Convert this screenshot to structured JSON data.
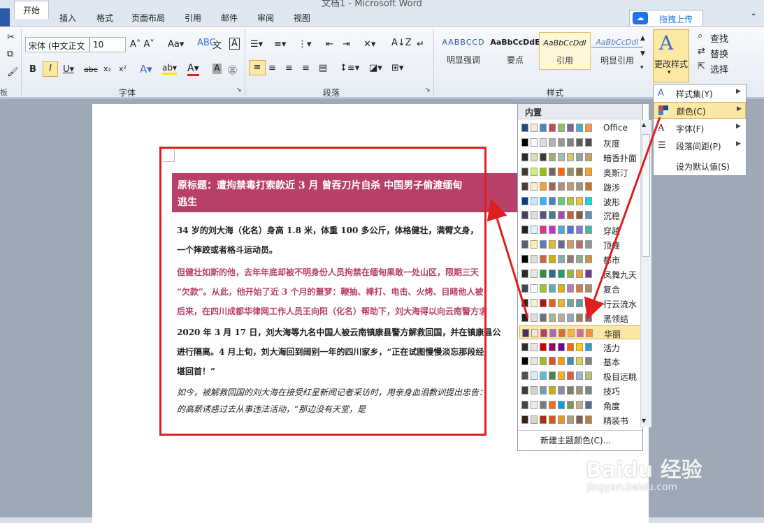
{
  "window": {
    "title": "文档1 - Microsoft Word"
  },
  "tabs": [
    "开始",
    "插入",
    "格式",
    "页面布局",
    "引用",
    "邮件",
    "审阅",
    "视图"
  ],
  "share": {
    "label": "拖拽上传"
  },
  "ribbon": {
    "font_name": "宋体 (中文正文",
    "font_size": "10",
    "groups": {
      "font": "字体",
      "paragraph": "段落",
      "styles": "样式"
    },
    "styles": [
      {
        "preview": "AABBCCD",
        "name": "明显强调"
      },
      {
        "preview": "AaBbCcDdE",
        "name": "要点"
      },
      {
        "preview": "AaBbCcDdI",
        "name": "引用"
      },
      {
        "preview": "AaBbCcDdI",
        "name": "明显引用"
      }
    ],
    "change_styles": "更改样式",
    "editing": {
      "find": "查找",
      "replace": "替换",
      "select": "选择"
    }
  },
  "document": {
    "title_line1": "原标题：遭拘禁毒打索款近 3 月  曾吞刀片自杀  中国男子偷渡缅甸",
    "title_line2": "逃生",
    "p1_line1": "34 岁的刘大海（化名）身高 1.8 米，体重 100 多公斤，体格健壮，满臂文身，",
    "p1_line2": "一个摔跤或者格斗运动员。",
    "p2_line1": "但健壮如斯的他，去年年底却被不明身份人员拘禁在缅甸果敢一处山区，限期三天",
    "p2_line2": "“欠款”。从此，他开始了近 3 个月的噩梦：鞭抽、棒打、电击、火烤、目睹他人被",
    "p2_line3": "后来，在四川成都华律网工作人员王向阳（化名）帮助下，刘大海得以向云南警方求",
    "p3_line1": "2020 年 3 月 17 日，刘大海等九名中国人被云南镇康县警方解救回国，并在镇康县公",
    "p3_line2": "进行隔离。4 月上旬，刘大海回到阔别一年的四川家乡，“正在试图慢慢淡忘那段经",
    "p3_line3": "堪回首！”",
    "p4_line1": "如今，被解救回国的刘大海在接受红星新闻记者采访时，用亲身血泪教训提出忠告：",
    "p4_line2": "的高薪诱惑过去从事违法活动，“那边没有天堂，是"
  },
  "theme_dropdown": {
    "header": "内置",
    "themes": [
      {
        "name": "Office",
        "colors": [
          "#1f497d",
          "#eeece1",
          "#4f81bd",
          "#c0504d",
          "#9bbb59",
          "#8064a2",
          "#4bacc6",
          "#f79646"
        ]
      },
      {
        "name": "灰度",
        "colors": [
          "#000000",
          "#f8f8f8",
          "#dddddd",
          "#b2b2b2",
          "#969696",
          "#808080",
          "#5f5f5f",
          "#4d4d4d"
        ]
      },
      {
        "name": "暗香扑面",
        "colors": [
          "#2f2b20",
          "#dfdcb7",
          "#3e3d2d",
          "#a9a57c",
          "#9cbebd",
          "#d2cb6c",
          "#95a39d",
          "#c89f5d"
        ]
      },
      {
        "name": "奥斯汀",
        "colors": [
          "#3e3d2d",
          "#caf278",
          "#94c600",
          "#71685a",
          "#ff6700",
          "#909465",
          "#956b43",
          "#fea022"
        ]
      },
      {
        "name": "跋涉",
        "colors": [
          "#4e3b30",
          "#fbeec9",
          "#f0a22e",
          "#a5644e",
          "#b58b80",
          "#c3986d",
          "#a19574",
          "#c17529"
        ]
      },
      {
        "name": "波形",
        "colors": [
          "#073e87",
          "#c6e7fc",
          "#31b6fd",
          "#4584d3",
          "#5bd078",
          "#a5d028",
          "#f5c040",
          "#05e0db"
        ]
      },
      {
        "name": "沉稳",
        "colors": [
          "#424456",
          "#dedede",
          "#53548a",
          "#438086",
          "#a04da3",
          "#c4652d",
          "#8b5d3d",
          "#5c92b5"
        ]
      },
      {
        "name": "穿越",
        "colors": [
          "#1f2123",
          "#dbf5f9",
          "#e32d91",
          "#c830cc",
          "#4ea6dc",
          "#4775e7",
          "#8971e1",
          "#3db9a8"
        ]
      },
      {
        "name": "顶峰",
        "colors": [
          "#575f6d",
          "#fff39d",
          "#4f81bd",
          "#e6b91e",
          "#6e6793",
          "#d89a5b",
          "#b57060",
          "#8a9a99"
        ]
      },
      {
        "name": "都市",
        "colors": [
          "#000000",
          "#dedede",
          "#d16349",
          "#ccb400",
          "#8cadae",
          "#8c7b70",
          "#8fb08c",
          "#d19049"
        ]
      },
      {
        "name": "凤舞九天",
        "colors": [
          "#2a2a2a",
          "#e5e8e8",
          "#3a8b3a",
          "#2e6c8f",
          "#1d9e6a",
          "#99b838",
          "#f0a22e",
          "#6b3a9a"
        ]
      },
      {
        "name": "复合",
        "colors": [
          "#454551",
          "#ffffff",
          "#98c723",
          "#59b0b9",
          "#deae00",
          "#b77bb4",
          "#e0773c",
          "#a98d63"
        ]
      },
      {
        "name": "行云流水",
        "colors": [
          "#4b1e0f",
          "#f5f2d1",
          "#b01513",
          "#ea6312",
          "#e6b729",
          "#6aac90",
          "#5f9c9d",
          "#9e5e9b"
        ]
      },
      {
        "name": "黑领结",
        "colors": [
          "#212121",
          "#dddddd",
          "#6f6f74",
          "#a7b789",
          "#beae98",
          "#92a9b9",
          "#9c8265",
          "#8d6974"
        ]
      },
      {
        "name": "华丽",
        "colors": [
          "#4a2f5a",
          "#f3e5ea",
          "#b83d68",
          "#ac66bb",
          "#de6c36",
          "#f9b639",
          "#cf6da4",
          "#fa8d3d"
        ]
      },
      {
        "name": "活力",
        "colors": [
          "#2c2c2c",
          "#e6e6e6",
          "#cc0000",
          "#990066",
          "#660099",
          "#ff6600",
          "#ffcc00",
          "#3399cc"
        ]
      },
      {
        "name": "基本",
        "colors": [
          "#000000",
          "#e9e5dc",
          "#a6b727",
          "#df5327",
          "#fe9e00",
          "#418ab3",
          "#d7d447",
          "#818183"
        ]
      },
      {
        "name": "极目远眺",
        "colors": [
          "#515151",
          "#d6ecff",
          "#53bfd1",
          "#4e8542",
          "#f4b321",
          "#e95937",
          "#9bb7d3",
          "#b7c16f"
        ]
      },
      {
        "name": "技巧",
        "colors": [
          "#3b3b3b",
          "#d4d2d0",
          "#6ea0b0",
          "#ccaf0a",
          "#8d89a4",
          "#748560",
          "#9e9273",
          "#7e848d"
        ]
      },
      {
        "name": "角度",
        "colors": [
          "#434342",
          "#ededed",
          "#797b7e",
          "#f96a1b",
          "#08a1d9",
          "#7c984a",
          "#c2ad8d",
          "#506e94"
        ]
      },
      {
        "name": "精装书",
        "colors": [
          "#332411",
          "#ddd4c2",
          "#a5300f",
          "#d55816",
          "#e19825",
          "#b19c7d",
          "#7f5f52",
          "#b27d49"
        ]
      }
    ],
    "selected": "华丽",
    "new_theme": "新建主题颜色(C)..."
  },
  "menu": {
    "items": [
      {
        "label": "样式集(Y)",
        "icon": "style-set-icon",
        "arrow": true
      },
      {
        "label": "颜色(C)",
        "icon": "palette-icon",
        "arrow": true
      },
      {
        "label": "字体(F)",
        "icon": "font-icon",
        "arrow": true
      },
      {
        "label": "段落间距(P)",
        "icon": "paragraph-spacing-icon",
        "arrow": true
      },
      {
        "label": "设为默认值(S)",
        "icon": "",
        "arrow": false
      }
    ]
  },
  "watermark": {
    "logo": "Baidu 经验",
    "url": "jingyan.baidu.com"
  }
}
